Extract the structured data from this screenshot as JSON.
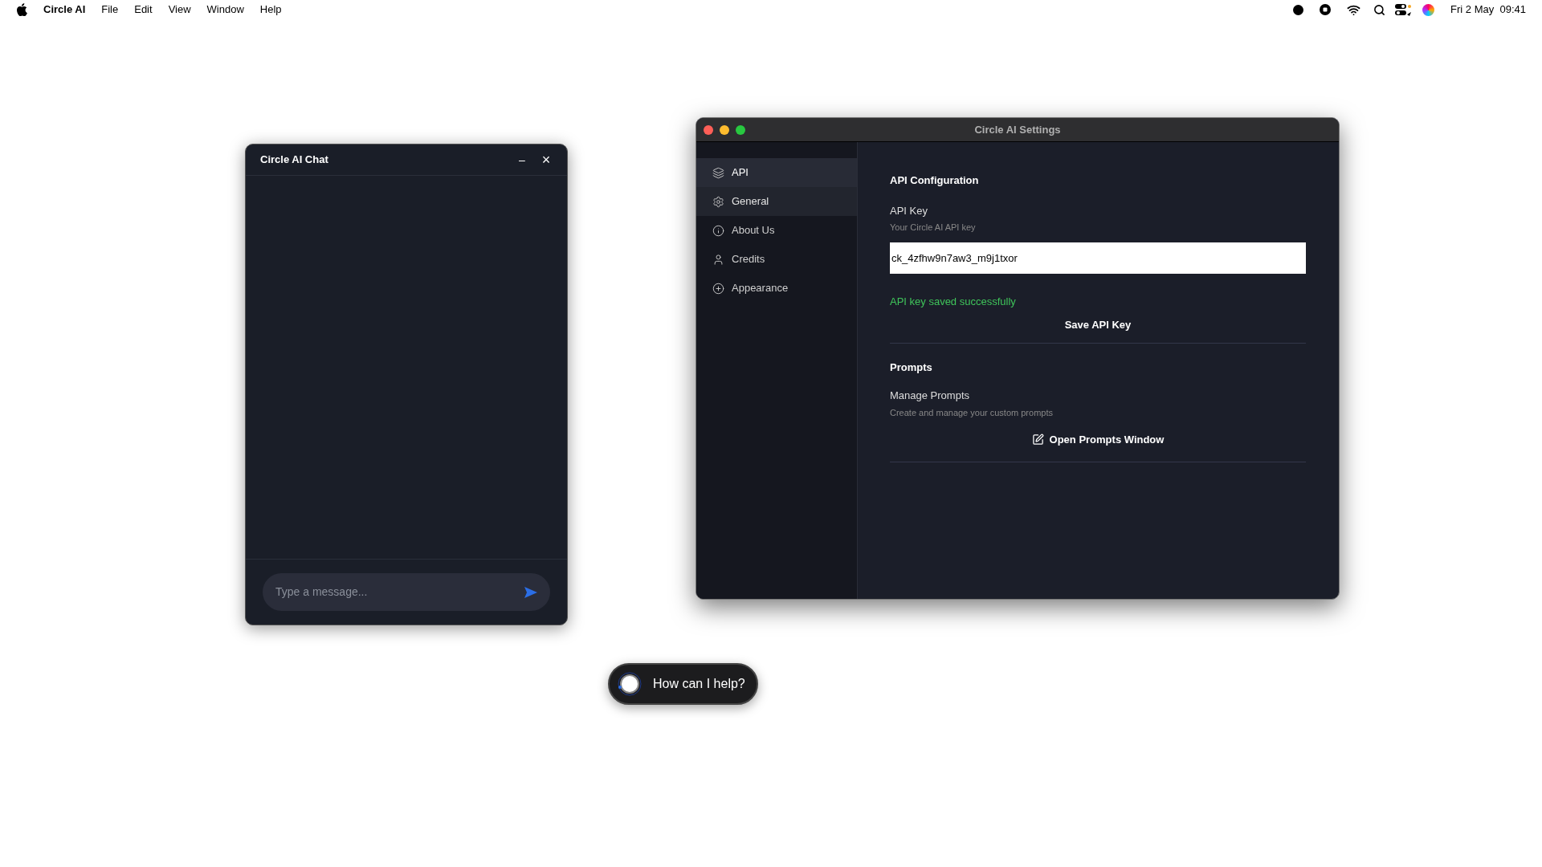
{
  "menu_bar": {
    "app_name": "Circle AI",
    "menus": [
      "File",
      "Edit",
      "View",
      "Window",
      "Help"
    ],
    "clock": "Fri 2 May  09:41"
  },
  "chat_window": {
    "title": "Circle AI Chat",
    "minimize": "–",
    "close": "×",
    "message_input": {
      "placeholder": "Type a message..."
    }
  },
  "settings_window": {
    "title": "Circle AI Settings",
    "sidebar": {
      "items": [
        {
          "label": "API",
          "kind": "layers",
          "selected": true,
          "hovered": false
        },
        {
          "label": "General",
          "kind": "gear",
          "selected": false,
          "hovered": true
        },
        {
          "label": "About Us",
          "kind": "info",
          "selected": false,
          "hovered": false
        },
        {
          "label": "Credits",
          "kind": "user",
          "selected": false,
          "hovered": false
        },
        {
          "label": "Appearance",
          "kind": "plus",
          "selected": false,
          "hovered": false
        }
      ]
    },
    "api_section": {
      "heading": "API Configuration",
      "field_label": "API Key",
      "field_hint": "Your Circle AI API key",
      "api_key": {
        "value": "ck_4zfhw9n7aw3_m9j1txor"
      },
      "status": "API key saved successfully",
      "save_button": "Save API Key"
    },
    "prompts_section": {
      "heading": "Prompts",
      "label": "Manage Prompts",
      "hint": "Create and manage your custom prompts",
      "open_button": "Open Prompts Window"
    }
  },
  "assistant_pill": {
    "text": "How can I help?"
  }
}
